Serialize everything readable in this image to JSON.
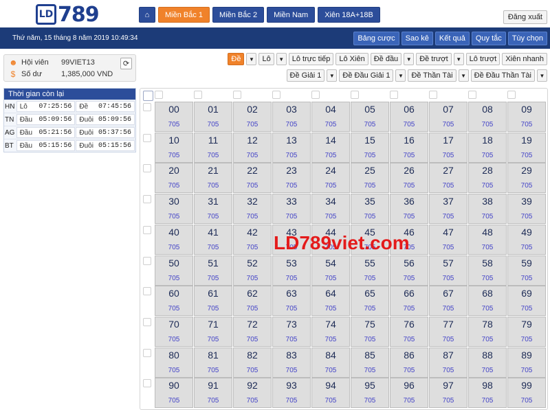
{
  "logo": {
    "text": "LD",
    "num": "789"
  },
  "nav": {
    "home_icon": "home-icon",
    "items": [
      "Miền Bắc 1",
      "Miền Bắc 2",
      "Miền Nam",
      "Xiên 18A+18B"
    ],
    "active": 0
  },
  "logout": "Đăng xuất",
  "datetime": "Thứ năm, 15 tháng 8 năm 2019 10:49:34",
  "rightnav": [
    "Bảng cược",
    "Sao kê",
    "Kết quả",
    "Quy tắc",
    "Tùy chọn"
  ],
  "user": {
    "member_label": "Hội viên",
    "member_value": "99VIET13",
    "balance_label": "Số dư",
    "balance_value": "1,385,000 VND"
  },
  "countdown": {
    "title": "Thời gian còn lại",
    "rows": [
      {
        "region": "HN",
        "a_label": "Lô",
        "a_time": "07:25:56",
        "b_label": "Đề",
        "b_time": "07:45:56"
      },
      {
        "region": "TN",
        "a_label": "Đầu",
        "a_time": "05:09:56",
        "b_label": "Đuôi",
        "b_time": "05:09:56"
      },
      {
        "region": "AG",
        "a_label": "Đầu",
        "a_time": "05:21:56",
        "b_label": "Đuôi",
        "b_time": "05:37:56"
      },
      {
        "region": "BT",
        "a_label": "Đầu",
        "a_time": "05:15:56",
        "b_label": "Đuôi",
        "b_time": "05:15:56"
      }
    ]
  },
  "bettypes_row1": [
    {
      "label": "Đề",
      "active": true,
      "caret": true
    },
    {
      "label": "Lô",
      "active": false,
      "caret": true
    },
    {
      "label": "Lô trực tiếp",
      "active": false,
      "caret": false
    },
    {
      "label": "Lô Xiên",
      "active": false,
      "caret": false
    },
    {
      "label": "Đề đầu",
      "active": false,
      "caret": true
    },
    {
      "label": "Đề trượt",
      "active": false,
      "caret": true
    },
    {
      "label": "Lô trượt",
      "active": false,
      "caret": false
    },
    {
      "label": "Xiên nhanh",
      "active": false,
      "caret": false
    }
  ],
  "bettypes_row2": [
    {
      "label": "Đề Giải 1",
      "caret": true
    },
    {
      "label": "Đề Đầu Giải 1",
      "caret": true
    },
    {
      "label": "Đề Thần Tài",
      "caret": true
    },
    {
      "label": "Đề Đầu Thần Tài",
      "caret": true
    }
  ],
  "odds": "705",
  "watermark": "LD789viet.com",
  "colors": {
    "brand_blue": "#1c3b78",
    "button_blue": "#2c4d9a",
    "accent_orange": "#f0822a",
    "odds_blue": "#4343c7"
  }
}
